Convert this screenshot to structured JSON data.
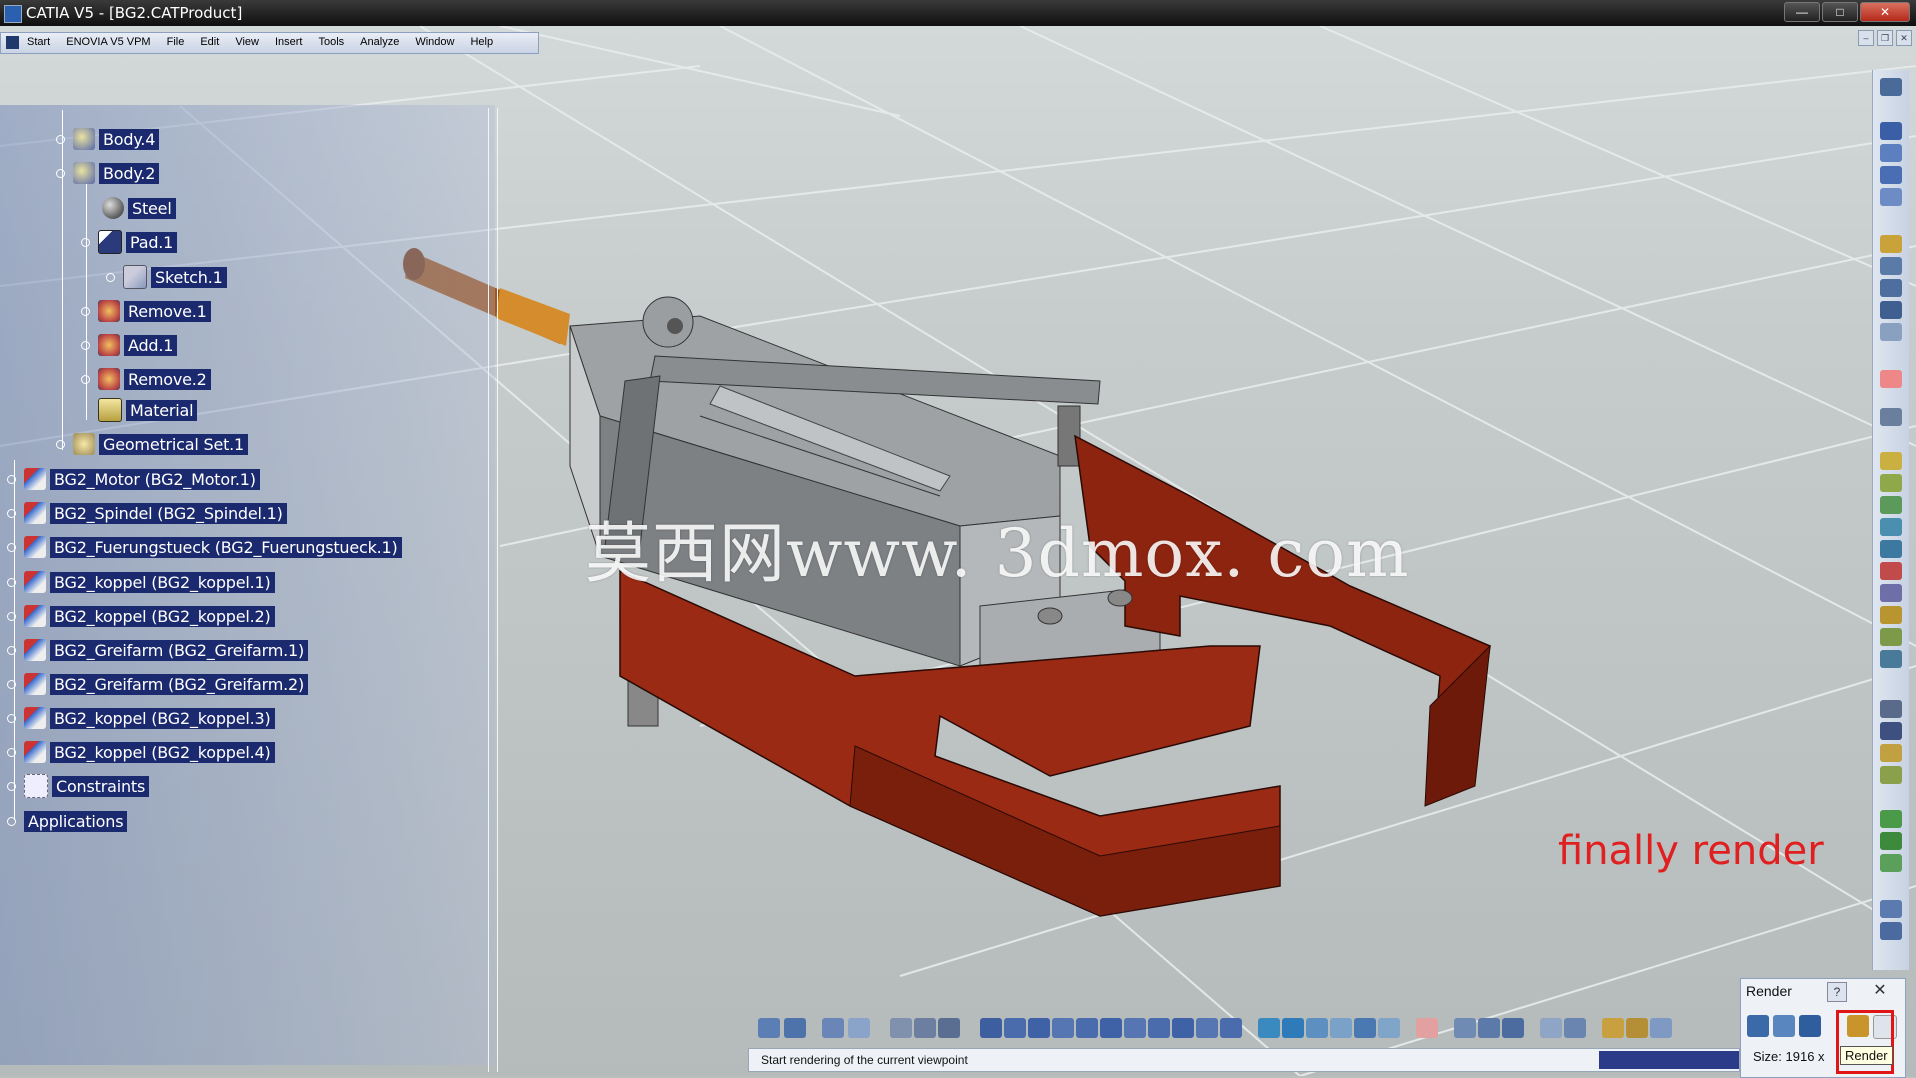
{
  "window": {
    "title": "CATIA V5 - [BG2.CATProduct]",
    "controls": {
      "minimize": "—",
      "maximize": "□",
      "close": "✕"
    }
  },
  "menubar": {
    "items": [
      "Start",
      "ENOVIA V5 VPM",
      "File",
      "Edit",
      "View",
      "Insert",
      "Tools",
      "Analyze",
      "Window",
      "Help"
    ]
  },
  "tree": {
    "items": [
      {
        "label": "Body.4",
        "icon": "body-icon"
      },
      {
        "label": "Body.2",
        "icon": "body-icon"
      },
      {
        "label": "Steel",
        "icon": "material-sphere-icon"
      },
      {
        "label": "Pad.1",
        "icon": "pad-icon"
      },
      {
        "label": "Sketch.1",
        "icon": "sketch-icon"
      },
      {
        "label": "Remove.1",
        "icon": "boolean-remove-icon"
      },
      {
        "label": "Add.1",
        "icon": "boolean-add-icon"
      },
      {
        "label": "Remove.2",
        "icon": "boolean-remove-icon"
      },
      {
        "label": "Material",
        "icon": "material-icon"
      },
      {
        "label": "Geometrical Set.1",
        "icon": "geometrical-set-icon"
      },
      {
        "label": "BG2_Motor (BG2_Motor.1)",
        "icon": "product-icon"
      },
      {
        "label": "BG2_Spindel (BG2_Spindel.1)",
        "icon": "product-icon"
      },
      {
        "label": "BG2_Fuerungstueck (BG2_Fuerungstueck.1)",
        "icon": "product-icon"
      },
      {
        "label": "BG2_koppel (BG2_koppel.1)",
        "icon": "product-icon"
      },
      {
        "label": "BG2_koppel (BG2_koppel.2)",
        "icon": "product-icon"
      },
      {
        "label": "BG2_Greifarm (BG2_Greifarm.1)",
        "icon": "product-icon"
      },
      {
        "label": "BG2_Greifarm (BG2_Greifarm.2)",
        "icon": "product-icon"
      },
      {
        "label": "BG2_koppel (BG2_koppel.3)",
        "icon": "product-icon"
      },
      {
        "label": "BG2_koppel (BG2_koppel.4)",
        "icon": "product-icon"
      },
      {
        "label": "Constraints",
        "icon": "constraints-icon"
      },
      {
        "label": "Applications",
        "icon": "applications-icon"
      }
    ]
  },
  "watermark": "莫西网www. 3dmox. com",
  "annotation": "finally render",
  "statusbar": {
    "text": "Start rendering of the current viewpoint"
  },
  "render_dialog": {
    "title": "Render",
    "help": "?",
    "close": "✕",
    "size_text": "Size: 1916 x",
    "tooltip": "Render"
  },
  "colors": {
    "tree_label_bg": "#1b2a6e",
    "annotation": "#e02020",
    "gripper_red": "#9a2a14",
    "highlight": "#e01515"
  }
}
